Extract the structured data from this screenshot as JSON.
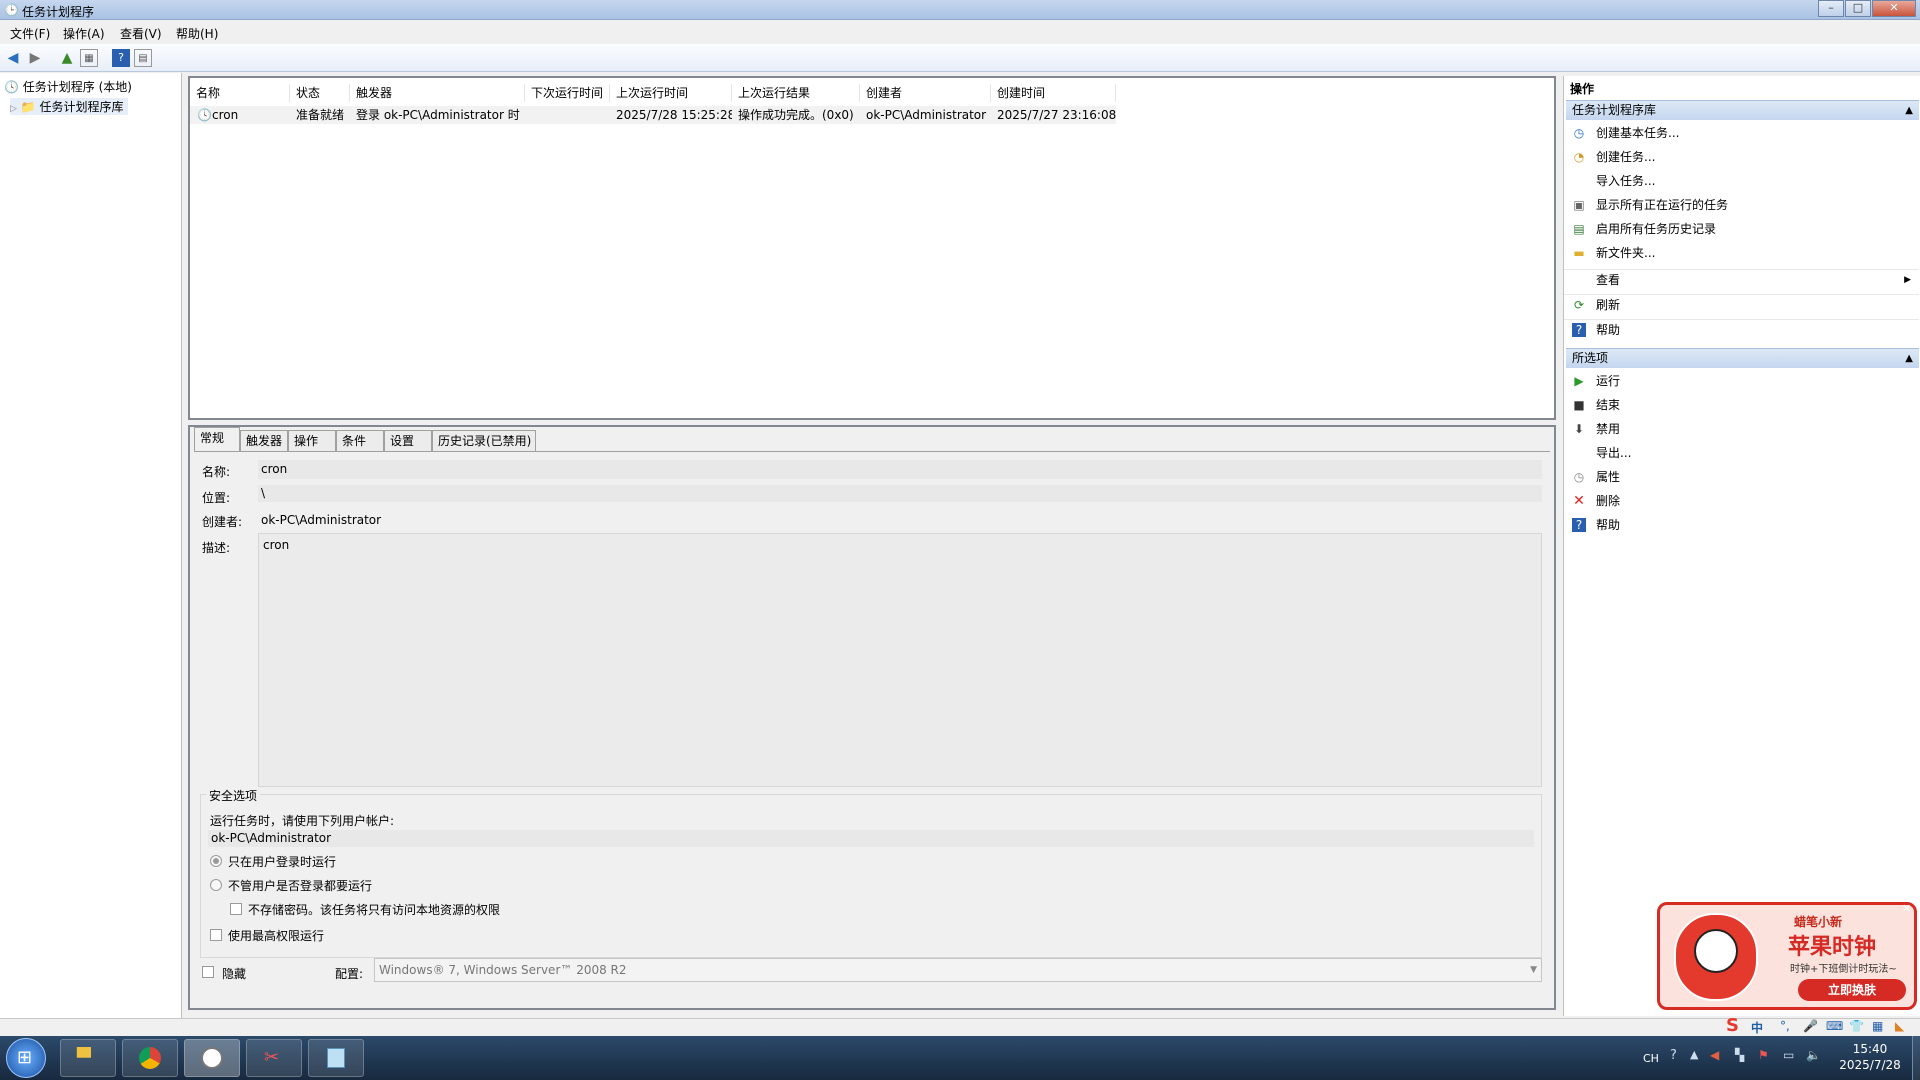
{
  "window": {
    "title": "任务计划程序"
  },
  "menu": [
    "文件(F)",
    "操作(A)",
    "查看(V)",
    "帮助(H)"
  ],
  "tree": {
    "root": "任务计划程序 (本地)",
    "child": "任务计划程序库"
  },
  "task_list": {
    "columns": [
      "名称",
      "状态",
      "触发器",
      "下次运行时间",
      "上次运行时间",
      "上次运行结果",
      "创建者",
      "创建时间"
    ],
    "rows": [
      [
        "cron",
        "准备就绪",
        "登录 ok-PC\\Administrator 时",
        "",
        "2025/7/28 15:25:28",
        "操作成功完成。(0x0)",
        "ok-PC\\Administrator",
        "2025/7/27 23:16:08"
      ]
    ]
  },
  "tabs": [
    "常规",
    "触发器",
    "操作",
    "条件",
    "设置",
    "历史记录(已禁用)"
  ],
  "general": {
    "name_label": "名称:",
    "name_value": "cron",
    "location_label": "位置:",
    "location_value": "\\",
    "author_label": "创建者:",
    "author_value": "ok-PC\\Administrator",
    "desc_label": "描述:",
    "desc_value": "cron",
    "security_title": "安全选项",
    "security_run_as": "运行任务时，请使用下列用户帐户:",
    "security_user": "ok-PC\\Administrator",
    "radio_logged_on": "只在用户登录时运行",
    "radio_whether": "不管用户是否登录都要运行",
    "chk_no_password": "不存储密码。该任务将只有访问本地资源的权限",
    "chk_highest": "使用最高权限运行",
    "chk_hidden": "隐藏",
    "config_label": "配置:",
    "config_value": "Windows® 7, Windows Server™ 2008 R2"
  },
  "actions": {
    "header": "操作",
    "section1_title": "任务计划程序库",
    "section1": [
      "创建基本任务...",
      "创建任务...",
      "导入任务...",
      "显示所有正在运行的任务",
      "启用所有任务历史记录",
      "新文件夹...",
      "查看",
      "刷新",
      "帮助"
    ],
    "section2_title": "所选项",
    "section2": [
      "运行",
      "结束",
      "禁用",
      "导出...",
      "属性",
      "删除",
      "帮助"
    ]
  },
  "ad": {
    "line1": "蜡笔小新",
    "line2": "苹果时钟",
    "line3": "时钟+下班倒计时玩法~",
    "button": "立即换肤"
  },
  "taskbar": {
    "lang": "CH",
    "ime": "中",
    "time": "15:40",
    "date": "2025/7/28"
  },
  "colors": {
    "accent": "#1f5fa8",
    "selection": "#cfe3fc",
    "ad_red": "#d62a24"
  }
}
